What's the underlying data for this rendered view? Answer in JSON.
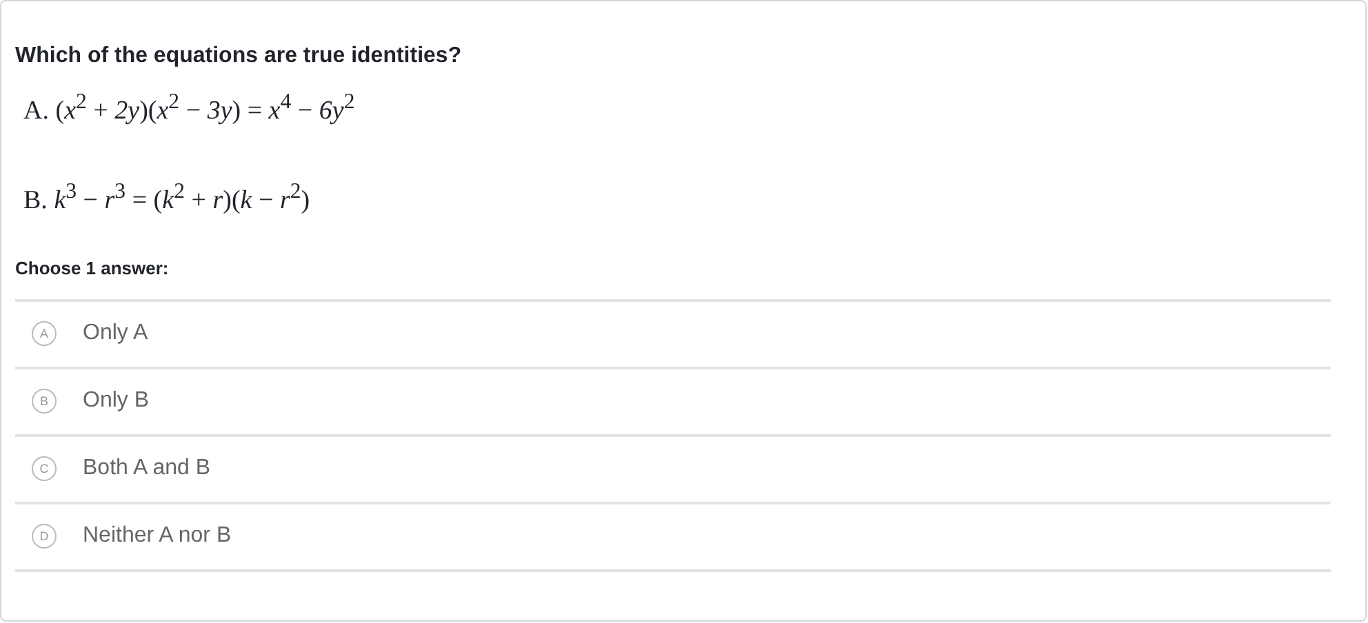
{
  "question": "Which of the equations are true identities?",
  "equations": [
    "A. (*x*$^{2}$ + *2y*)(*x*$^{2}$ − *3y*) = *x*$^{4}$ − *6y*$^{2}$",
    "B. *k*$^{3}$ − *r*$^{3}$ = (*k*$^{2}$ + *r*)(*k* − *r*$^{2}$)"
  ],
  "prompt": "Choose 1 answer:",
  "choices": [
    {
      "letter": "A",
      "text": "Only A",
      "selected": false
    },
    {
      "letter": "B",
      "text": "Only B",
      "selected": false
    },
    {
      "letter": "C",
      "text": "Both A and B",
      "selected": false
    },
    {
      "letter": "D",
      "text": "Neither A nor B",
      "selected": false
    }
  ]
}
